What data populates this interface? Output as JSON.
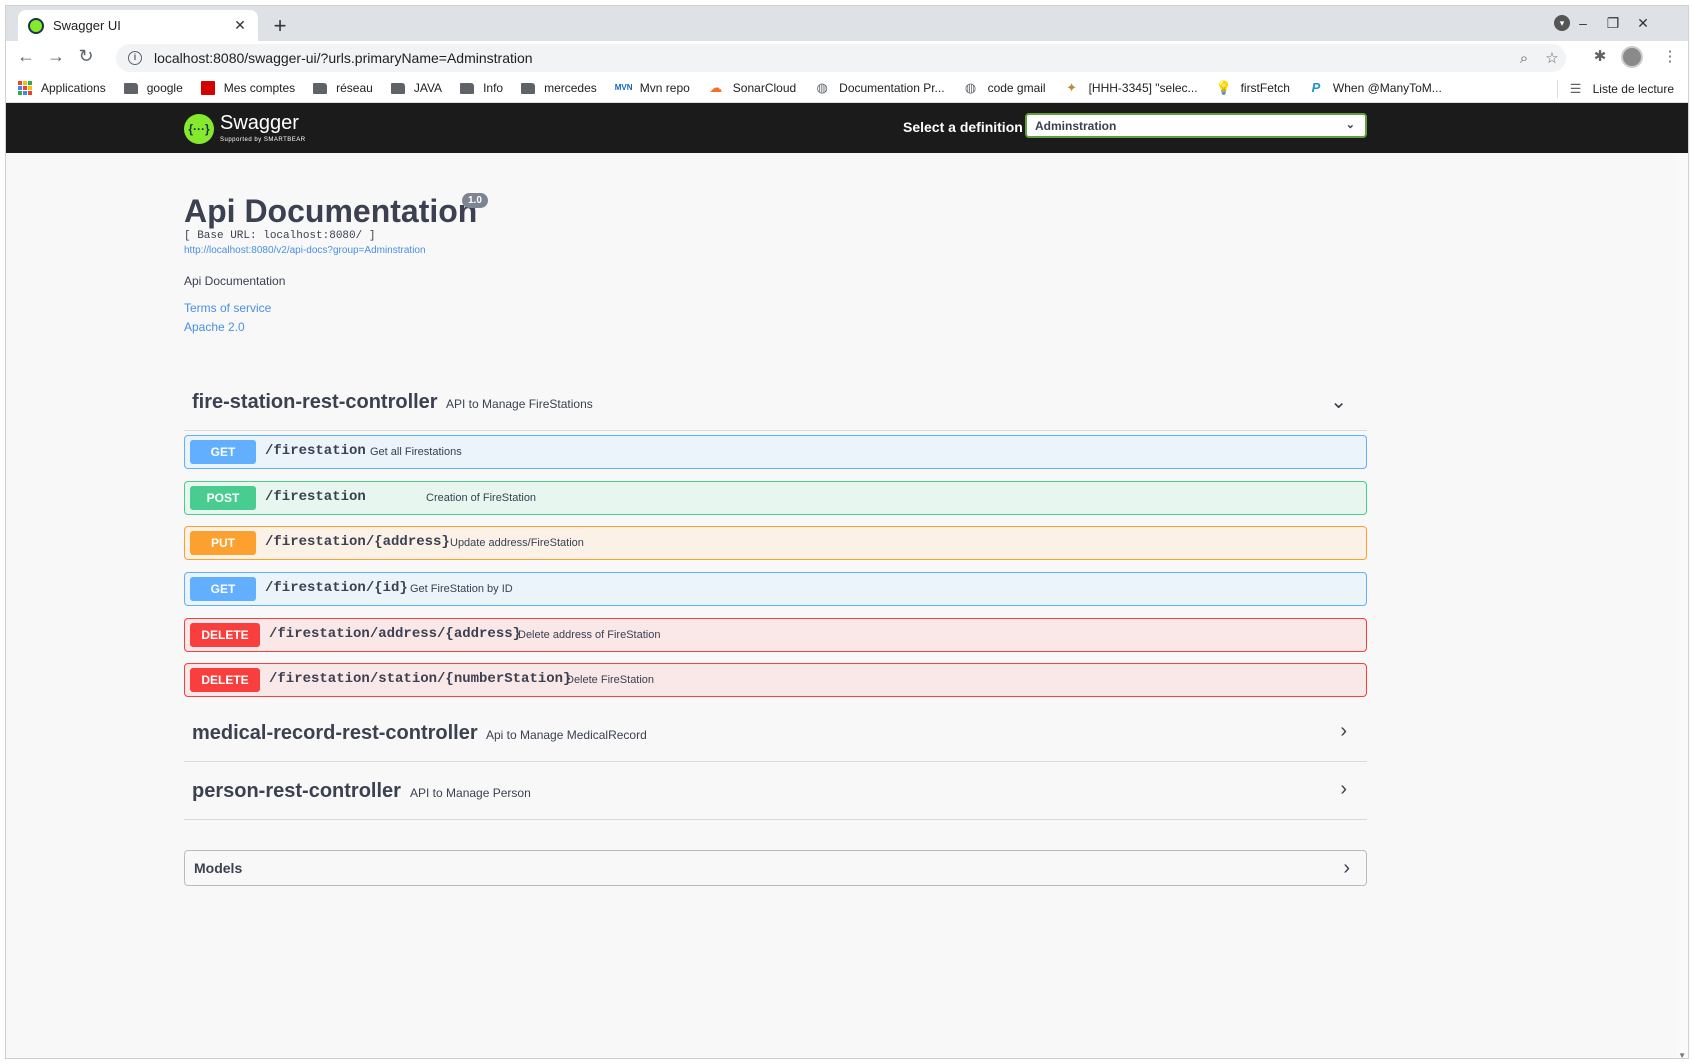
{
  "browser": {
    "tab_title": "Swagger UI",
    "tab_close": "✕",
    "new_tab": "+",
    "url": "localhost:8080/swagger-ui/?urls.primaryName=Adminstration",
    "bookmarks": [
      {
        "label": "Applications",
        "icon": "apps-grid-icon"
      },
      {
        "label": "google",
        "icon": "folder-icon"
      },
      {
        "label": "Mes comptes",
        "icon": "bank-icon"
      },
      {
        "label": "réseau",
        "icon": "folder-icon"
      },
      {
        "label": "JAVA",
        "icon": "folder-icon"
      },
      {
        "label": "Info",
        "icon": "folder-icon"
      },
      {
        "label": "mercedes",
        "icon": "folder-icon"
      },
      {
        "label": "Mvn repo",
        "icon": "mvn-icon"
      },
      {
        "label": "SonarCloud",
        "icon": "sonarcloud-icon"
      },
      {
        "label": "Documentation Pr...",
        "icon": "globe-icon"
      },
      {
        "label": "code gmail",
        "icon": "globe-icon"
      },
      {
        "label": "[HHH-3345] \"selec...",
        "icon": "jira-icon"
      },
      {
        "label": "firstFetch",
        "icon": "bulb-icon"
      },
      {
        "label": "When @ManyToM...",
        "icon": "p-icon"
      }
    ],
    "reading_list": "Liste de lecture"
  },
  "swagger": {
    "logo_text": "Swagger",
    "logo_sub": "Supported by SMARTBEAR",
    "definition_label": "Select a definition",
    "definition_value": "Adminstration",
    "title": "Api Documentation",
    "version": "1.0",
    "base_url": "[ Base URL: localhost:8080/ ]",
    "api_docs_link": "http://localhost:8080/v2/api-docs?group=Adminstration",
    "description": "Api Documentation",
    "terms": "Terms of service",
    "license": "Apache 2.0"
  },
  "tags": [
    {
      "name": "fire-station-rest-controller",
      "description": "API to Manage FireStations",
      "expanded": true
    },
    {
      "name": "medical-record-rest-controller",
      "description": "Api to Manage MedicalRecord",
      "expanded": false
    },
    {
      "name": "person-rest-controller",
      "description": "API to Manage Person",
      "expanded": false
    }
  ],
  "operations": [
    {
      "method": "GET",
      "path": "/firestation",
      "summary": "Get all Firestations"
    },
    {
      "method": "POST",
      "path": "/firestation",
      "summary": "Creation of FireStation"
    },
    {
      "method": "PUT",
      "path": "/firestation/{address}",
      "summary": "Update address/FireStation"
    },
    {
      "method": "GET",
      "path": "/firestation/{id}",
      "summary": "Get FireStation by ID"
    },
    {
      "method": "DELETE",
      "path": "/firestation/address/{address}",
      "summary": "Delete address of FireStation"
    },
    {
      "method": "DELETE",
      "path": "/firestation/station/{numberStation}",
      "summary": "Delete FireStation"
    }
  ],
  "models_label": "Models",
  "colors": {
    "get": "#61affe",
    "post": "#49cc90",
    "put": "#fca130",
    "delete": "#f93e3e",
    "swagger_green": "#85ea2d"
  }
}
